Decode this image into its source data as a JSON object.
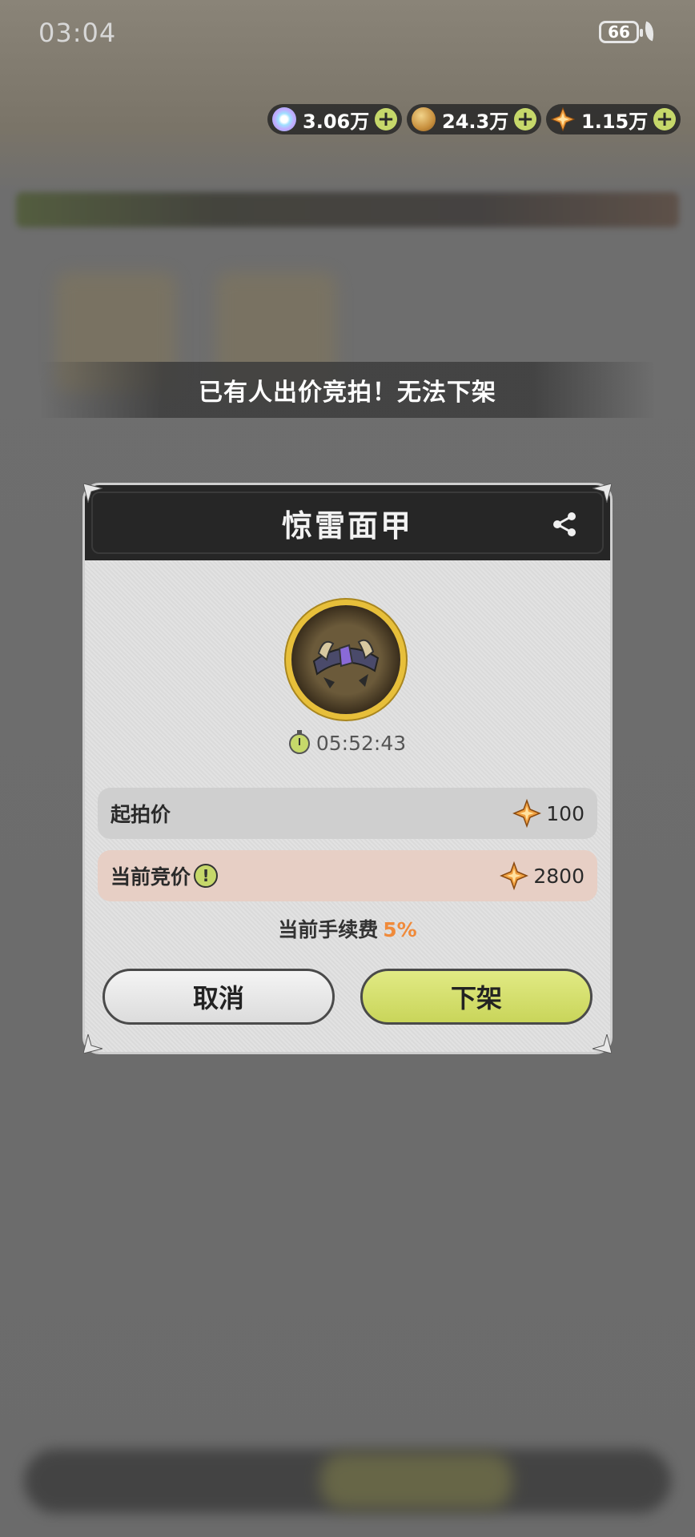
{
  "status_bar": {
    "time": "03:04",
    "battery": "66"
  },
  "currencies": [
    {
      "icon": "crystal-icon",
      "amount": "3.06万"
    },
    {
      "icon": "coin-icon",
      "amount": "24.3万"
    },
    {
      "icon": "star-gem-icon",
      "amount": "1.15万"
    }
  ],
  "toast": {
    "message": "已有人出价竞拍！无法下架"
  },
  "dialog": {
    "title": "惊雷面甲",
    "timer": "05:52:43",
    "start_price": {
      "label": "起拍价",
      "value": "100"
    },
    "current_bid": {
      "label": "当前竞价",
      "value": "2800"
    },
    "fee": {
      "label": "当前手续费",
      "percent": "5%"
    },
    "cancel_label": "取消",
    "unlist_label": "下架"
  },
  "colors": {
    "accent_yellow": "#c9d55a",
    "fee_orange": "#f08a3a",
    "header_dark": "#262626"
  }
}
